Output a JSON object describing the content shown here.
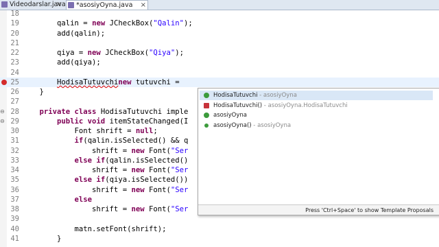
{
  "tabs": [
    {
      "label": "Videodarslar.java",
      "close": "×"
    },
    {
      "label": "*asosiyOyna.java",
      "close": "×"
    }
  ],
  "lines": [
    {
      "num": "18",
      "code": ""
    },
    {
      "num": "19",
      "pre": "        qalin = ",
      "kw": "new",
      "post": " JCheckBox(",
      "str": "\"Qalin\"",
      "end": ");"
    },
    {
      "num": "20",
      "code": "        add(qalin);"
    },
    {
      "num": "21",
      "code": ""
    },
    {
      "num": "22",
      "pre": "        qiya = ",
      "kw": "new",
      "post": " JCheckBox(",
      "str": "\"Qiya\"",
      "end": ");"
    },
    {
      "num": "23",
      "code": "        add(qiya);"
    },
    {
      "num": "24",
      "code": ""
    },
    {
      "num": "25",
      "pre": "        ",
      "errtext": "HodisaTutuvchi",
      "post": " tutuvchi = ",
      "kw": "new",
      "end": " "
    },
    {
      "num": "26",
      "code": "    }"
    },
    {
      "num": "27",
      "code": ""
    },
    {
      "num": "28",
      "pre": "    ",
      "kw": "private class",
      "post": " HodisaTutuvchi imple"
    },
    {
      "num": "29",
      "pre": "        ",
      "kw": "public void",
      "post": " itemStateChanged(I"
    },
    {
      "num": "30",
      "pre": "            Font shrift = ",
      "kw": "null",
      "end": ";"
    },
    {
      "num": "31",
      "pre": "            ",
      "kw": "if",
      "post": "(qalin.isSelected() && q"
    },
    {
      "num": "32",
      "pre": "                shrift = ",
      "kw": "new",
      "post": " Font(",
      "str": "\"Ser"
    },
    {
      "num": "33",
      "pre": "            ",
      "kw": "else if",
      "post": "(qalin.isSelected()"
    },
    {
      "num": "34",
      "pre": "                shrift = ",
      "kw": "new",
      "post": " Font(",
      "str": "\"Ser"
    },
    {
      "num": "35",
      "pre": "            ",
      "kw": "else if",
      "post": "(qiya.isSelected())"
    },
    {
      "num": "36",
      "pre": "                shrift = ",
      "kw": "new",
      "post": " Font(",
      "str": "\"Ser"
    },
    {
      "num": "37",
      "pre": "            ",
      "kw": "else",
      "post": ""
    },
    {
      "num": "38",
      "pre": "                shrift = ",
      "kw": "new",
      "post": " Font(",
      "str": "\"Ser"
    },
    {
      "num": "39",
      "code": ""
    },
    {
      "num": "40",
      "code": "            matn.setFont(shrift);"
    },
    {
      "num": "41",
      "code": "        }"
    }
  ],
  "autocomplete": {
    "items": [
      {
        "name": "HodisaTutuvchi",
        "qual": " - asosiyOyna",
        "icon": "class-icon",
        "selected": true
      },
      {
        "name": "HodisaTutuvchi()",
        "qual": " - asosiyOyna.HodisaTutuvchi",
        "icon": "constructor-icon",
        "selected": false
      },
      {
        "name": "asosiyOyna",
        "qual": "",
        "icon": "class-icon",
        "selected": false
      },
      {
        "name": "asosiyOyna()",
        "qual": " - asosiyOyna",
        "icon": "constructor-icon",
        "selected": false
      }
    ],
    "footer": "Press 'Ctrl+Space' to show Template Proposals"
  },
  "colors": {
    "keyword": "#7f0055",
    "string": "#2a00ff",
    "error": "#d42c2c",
    "current_line": "#e8f2fe"
  }
}
